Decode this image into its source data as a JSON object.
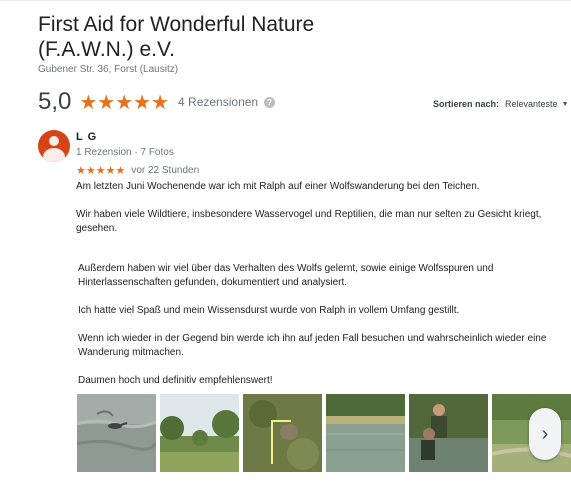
{
  "place": {
    "title_line1": "First Aid for Wonderful Nature",
    "title_line2": "(F.A.W.N.) e.V.",
    "address": "Gubener Str. 36, Forst (Lausitz)"
  },
  "summary": {
    "score": "5,0",
    "stars": "★★★★★",
    "review_count": "4 Rezensionen",
    "help_icon": "question-icon"
  },
  "sort": {
    "label": "Sortieren nach:",
    "value": "Relevanteste"
  },
  "review": {
    "author": "L G",
    "meta": "1 Rezension · 7 Fotos",
    "stars": "★★★★★",
    "rating": 5,
    "time": "vor 22 Stunden",
    "paragraphs": [
      "Am letzten Juni Wochenende war ich mit Ralph auf einer Wolfswanderung bei den Teichen.",
      "Wir haben viele Wildtiere, insbesondere Wasservogel und Reptilien, die man nur selten zu Gesicht kriegt, gesehen.",
      "Außerdem haben wir viel über das Verhalten des Wolfs gelernt, sowie einige Wolfsspuren und Hinterlassenschaften gefunden, dokumentiert und analysiert.",
      "Ich hatte viel Spaß und mein Wissensdurst wurde von Ralph in vollem Umfang gestillt.",
      "Wenn ich wieder in der Gegend bin werde ich ihn auf jeden Fall besuchen und wahrscheinlich wieder eine Wanderung mitmachen.",
      "Daumen hoch und definitiv empfehlenswert!"
    ],
    "photos": [
      "photo-1",
      "photo-2",
      "photo-3",
      "photo-4",
      "photo-5",
      "photo-6"
    ]
  },
  "colors": {
    "star": "#e7711b",
    "avatar": "#d84315"
  }
}
